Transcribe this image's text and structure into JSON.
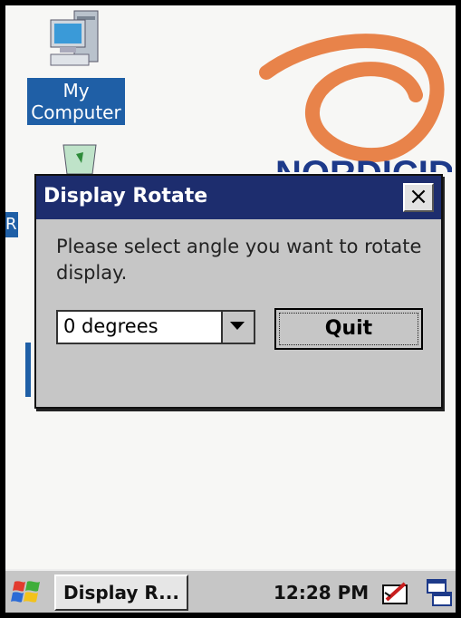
{
  "desktop": {
    "icons": [
      {
        "label_line1": "My",
        "label_line2": "Computer",
        "icon": "my-computer-icon"
      },
      {
        "label": "R",
        "icon": "recycle-bin-icon"
      }
    ],
    "logo_text": "NORDICID"
  },
  "dialog": {
    "title": "Display Rotate",
    "close_label": "×",
    "message": "Please select angle you want to rotate display.",
    "angle_select": {
      "value": "0 degrees"
    },
    "quit_label": "Quit"
  },
  "taskbar": {
    "start_icon": "windows-flag-icon",
    "task_button_label": "Display R...",
    "clock": "12:28 PM",
    "tray_icons": [
      "input-panel-icon",
      "show-desktop-icon"
    ]
  },
  "colors": {
    "titlebar": "#1d2d6e",
    "dialog_bg": "#c6c6c6",
    "selection_blue": "#1f5fa6",
    "logo_orange": "#e8834a",
    "logo_blue": "#1d3a8a"
  }
}
